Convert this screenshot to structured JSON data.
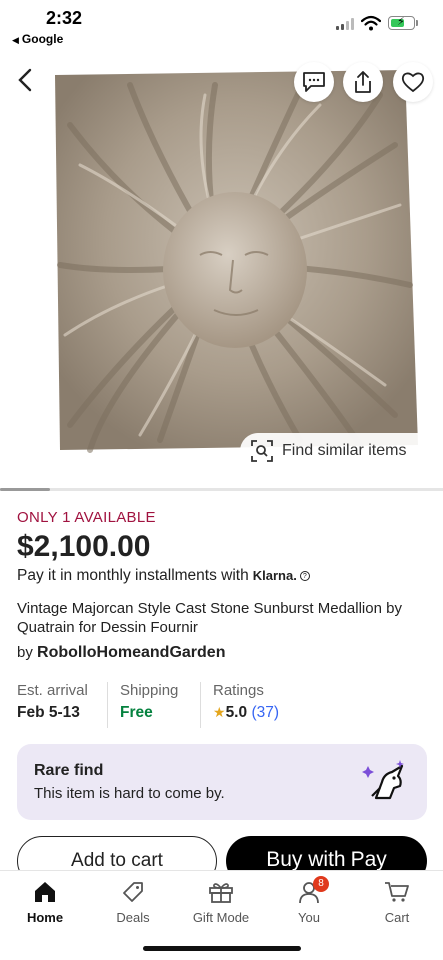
{
  "status_bar": {
    "time": "2:32",
    "back_app": "Google"
  },
  "hero": {
    "find_similar_label": "Find similar items"
  },
  "listing": {
    "availability": "ONLY 1 AVAILABLE",
    "price": "$2,100.00",
    "installments": "Pay it in monthly installments with",
    "installments_provider": "Klarna.",
    "title": "Vintage Majorcan Style Cast Stone Sunburst Medallion by Quatrain for Dessin Fournir",
    "seller_prefix": "by",
    "seller": "RobolloHomeandGarden"
  },
  "stats": {
    "arrival_label": "Est. arrival",
    "arrival_value": "Feb 5-13",
    "shipping_label": "Shipping",
    "shipping_value": "Free",
    "ratings_label": "Ratings",
    "rating_value": "5.0",
    "rating_count": "(37)"
  },
  "rare": {
    "heading": "Rare find",
    "description": "This item is hard to come by."
  },
  "actions": {
    "add_to_cart": "Add to cart",
    "buy_with": "Buy with",
    "pay": "Pay"
  },
  "bottom_nav": {
    "items": [
      {
        "label": "Home",
        "icon": "home-icon",
        "active": true
      },
      {
        "label": "Deals",
        "icon": "tag-icon"
      },
      {
        "label": "Gift Mode",
        "icon": "gift-icon"
      },
      {
        "label": "You",
        "icon": "user-icon",
        "badge": "8"
      },
      {
        "label": "Cart",
        "icon": "cart-icon"
      }
    ]
  },
  "colors": {
    "availability": "#a0123f",
    "free": "#05823f",
    "rating_count": "#3665f3",
    "rare_bg": "#ece8f5",
    "badge": "#e0391c"
  }
}
